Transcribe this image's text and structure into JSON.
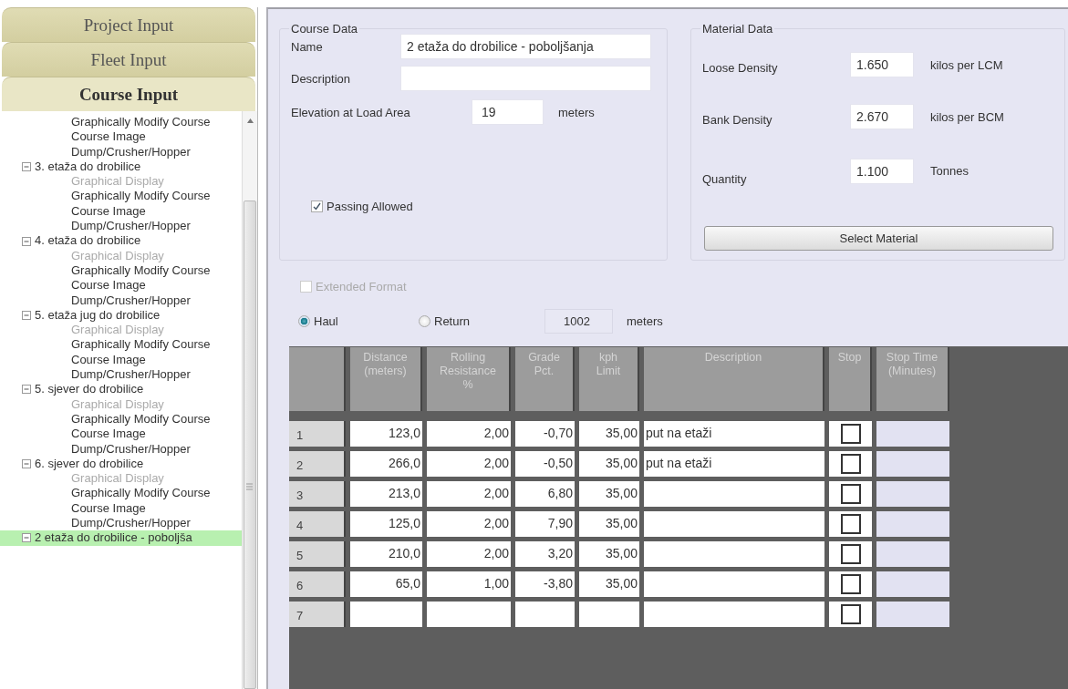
{
  "sidebar": {
    "sections": [
      {
        "label": "Project Input",
        "selected": false
      },
      {
        "label": "Fleet Input",
        "selected": false
      },
      {
        "label": "Course Input",
        "selected": true
      }
    ],
    "tree": [
      {
        "children": [
          {
            "label": "Graphically Modify Course",
            "disabled": false,
            "selected": false
          },
          {
            "label": "Course Image",
            "disabled": false,
            "selected": false
          },
          {
            "label": "Dump/Crusher/Hopper",
            "disabled": false,
            "selected": false
          }
        ]
      },
      {
        "label": "3. etaža do drobilice",
        "expanded": true,
        "selected": false,
        "children": [
          {
            "label": "Graphical Display",
            "disabled": true,
            "selected": false
          },
          {
            "label": "Graphically Modify Course",
            "disabled": false,
            "selected": false
          },
          {
            "label": "Course Image",
            "disabled": false,
            "selected": false
          },
          {
            "label": "Dump/Crusher/Hopper",
            "disabled": false,
            "selected": false
          }
        ]
      },
      {
        "label": "4. etaža do drobilice",
        "expanded": true,
        "selected": false,
        "children": [
          {
            "label": "Graphical Display",
            "disabled": true,
            "selected": false
          },
          {
            "label": "Graphically Modify Course",
            "disabled": false,
            "selected": false
          },
          {
            "label": "Course Image",
            "disabled": false,
            "selected": false
          },
          {
            "label": "Dump/Crusher/Hopper",
            "disabled": false,
            "selected": false
          }
        ]
      },
      {
        "label": "5. etaža jug do drobilice",
        "expanded": true,
        "selected": false,
        "children": [
          {
            "label": "Graphical Display",
            "disabled": true,
            "selected": false
          },
          {
            "label": "Graphically Modify Course",
            "disabled": false,
            "selected": false
          },
          {
            "label": "Course Image",
            "disabled": false,
            "selected": false
          },
          {
            "label": "Dump/Crusher/Hopper",
            "disabled": false,
            "selected": false
          }
        ]
      },
      {
        "label": "5. sjever do drobilice",
        "expanded": true,
        "selected": false,
        "children": [
          {
            "label": "Graphical Display",
            "disabled": true,
            "selected": false
          },
          {
            "label": "Graphically Modify Course",
            "disabled": false,
            "selected": false
          },
          {
            "label": "Course Image",
            "disabled": false,
            "selected": false
          },
          {
            "label": "Dump/Crusher/Hopper",
            "disabled": false,
            "selected": false
          }
        ]
      },
      {
        "label": "6. sjever do drobilice",
        "expanded": true,
        "selected": false,
        "children": [
          {
            "label": "Graphical Display",
            "disabled": true,
            "selected": false
          },
          {
            "label": "Graphically Modify Course",
            "disabled": false,
            "selected": false
          },
          {
            "label": "Course Image",
            "disabled": false,
            "selected": false
          },
          {
            "label": "Dump/Crusher/Hopper",
            "disabled": false,
            "selected": false
          }
        ]
      },
      {
        "label": "2 etaža do drobilice - poboljša",
        "expanded": true,
        "selected": true
      }
    ]
  },
  "course_data": {
    "title": "Course Data",
    "name": {
      "label": "Name",
      "value": "2 etaža do drobilice - poboljšanja"
    },
    "description": {
      "label": "Description"
    },
    "elevation": {
      "label": "Elevation at Load Area",
      "value": "19",
      "unit": "meters"
    },
    "passing_allowed": {
      "label": "Passing Allowed",
      "checked": true
    }
  },
  "material_data": {
    "title": "Material Data",
    "fields": [
      {
        "label": "Loose Density",
        "value": "1.650",
        "unit": "kilos per LCM"
      },
      {
        "label": "Bank Density",
        "value": "2.670",
        "unit": "kilos per BCM"
      },
      {
        "label": "Quantity",
        "value": "1.100",
        "unit": "Tonnes"
      }
    ],
    "button": "Select Material"
  },
  "extended_format": {
    "label": "Extended Format",
    "checked": false,
    "disabled": true
  },
  "direction": {
    "options": [
      {
        "label": "Haul",
        "selected": true
      },
      {
        "label": "Return",
        "selected": false
      }
    ],
    "total": "1002",
    "unit": "meters"
  },
  "table": {
    "columns": [
      "Distance\n(meters)",
      "Rolling\nResistance\n%",
      "Grade\nPct.",
      "kph\nLimit",
      "Description",
      "Stop",
      "Stop Time\n(Minutes)"
    ],
    "rows": [
      {
        "number": "1",
        "distance": "123,0",
        "rolling": "2,00",
        "grade": "-0,70",
        "limit": "35,00",
        "description": "put na etaži",
        "stop": false
      },
      {
        "number": "2",
        "distance": "266,0",
        "rolling": "2,00",
        "grade": "-0,50",
        "limit": "35,00",
        "description": "put na etaži",
        "stop": false
      },
      {
        "number": "3",
        "distance": "213,0",
        "rolling": "2,00",
        "grade": "6,80",
        "limit": "35,00",
        "stop": false
      },
      {
        "number": "4",
        "distance": "125,0",
        "rolling": "2,00",
        "grade": "7,90",
        "limit": "35,00",
        "stop": false
      },
      {
        "number": "5",
        "distance": "210,0",
        "rolling": "2,00",
        "grade": "3,20",
        "limit": "35,00",
        "stop": false
      },
      {
        "number": "6",
        "distance": "65,0",
        "rolling": "1,00",
        "grade": "-3,80",
        "limit": "35,00",
        "stop": false
      },
      {
        "number": "7",
        "stop": false
      }
    ]
  }
}
